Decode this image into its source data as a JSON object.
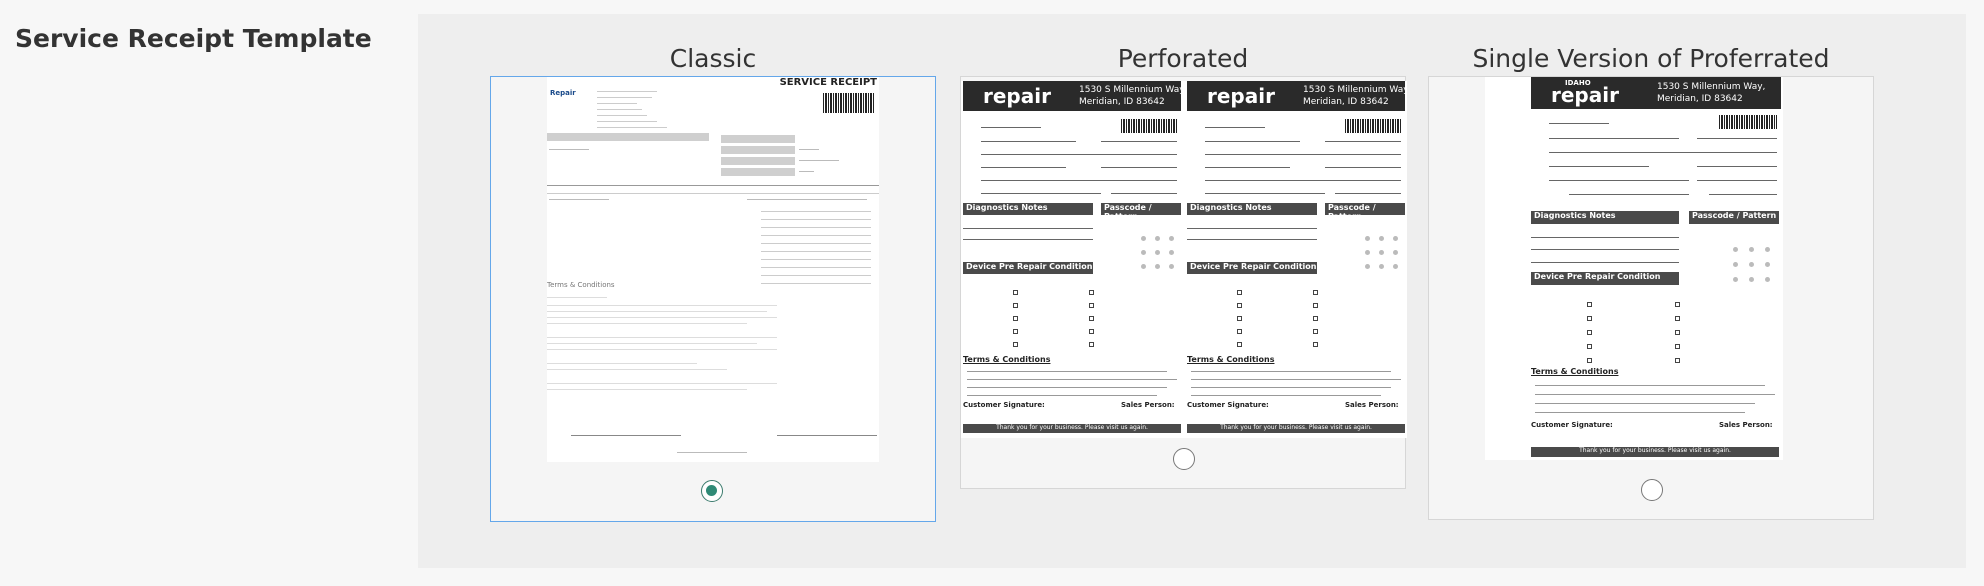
{
  "section_title": "Service Receipt Template",
  "options": [
    {
      "label": "Classic",
      "selected": true
    },
    {
      "label": "Perforated",
      "selected": false
    },
    {
      "label": "Single Version of Proferrated",
      "selected": false
    }
  ],
  "receipt": {
    "brand_small": "IDAHO",
    "brand": "repair",
    "address_line1": "1530 S Millennium Way,",
    "address_line2": "Meridian, ID 83642",
    "classic_title": "SERVICE RECEIPT",
    "diagnostics": "Diagnostics Notes",
    "passcode": "Passcode / Pattern",
    "pre_repair": "Device Pre Repair Condition",
    "terms": "Terms & Conditions",
    "customer_signature": "Customer Signature:",
    "sales_person": "Sales Person:",
    "footer": "Thank you for your business. Please visit us again."
  }
}
